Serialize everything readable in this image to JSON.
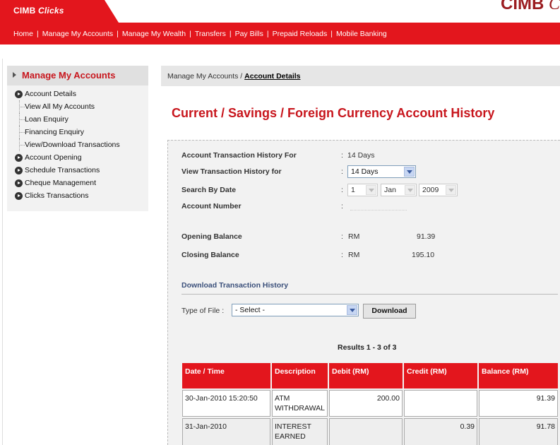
{
  "brand": {
    "name": "CIMB",
    "name_italic": "Clicks",
    "logo_right": "CIMB",
    "logo_right_tail": "C"
  },
  "colors": {
    "accent": "#e3161d",
    "title_red": "#c8161d",
    "link_blue": "#3a4f7a"
  },
  "nav": {
    "items": [
      "Home",
      "Manage My Accounts",
      "Manage My Wealth",
      "Transfers",
      "Pay Bills",
      "Prepaid Reloads",
      "Mobile Banking"
    ]
  },
  "sidebar": {
    "title": "Manage My Accounts",
    "items": [
      {
        "label": "Account Details",
        "type": "main"
      },
      {
        "label": "View All My Accounts",
        "type": "sub"
      },
      {
        "label": "Loan Enquiry",
        "type": "sub"
      },
      {
        "label": "Financing Enquiry",
        "type": "sub"
      },
      {
        "label": "View/Download Transactions",
        "type": "sub"
      },
      {
        "label": "Account Opening",
        "type": "main"
      },
      {
        "label": "Schedule Transactions",
        "type": "main"
      },
      {
        "label": "Cheque Management",
        "type": "main"
      },
      {
        "label": "Clicks Transactions",
        "type": "main"
      }
    ]
  },
  "breadcrumb": {
    "parent": "Manage My Accounts /",
    "current": "Account Details"
  },
  "page_title": "Current / Savings / Foreign Currency Account History",
  "form": {
    "history_for_label": "Account Transaction History For",
    "history_for_value": "14 Days",
    "view_label": "View Transaction History for",
    "view_select": "14 Days",
    "search_label": "Search By Date",
    "day": "1",
    "month": "Jan",
    "year": "2009",
    "account_label": "Account Number",
    "opening_label": "Opening Balance",
    "opening_currency": "RM",
    "opening_value": "91.39",
    "closing_label": "Closing Balance",
    "closing_currency": "RM",
    "closing_value": "195.10",
    "colon": ":"
  },
  "download": {
    "title": "Download Transaction History",
    "file_label": "Type of File :",
    "file_select": "- Select -",
    "button": "Download"
  },
  "results_text": "Results 1 - 3 of 3",
  "table": {
    "headers": [
      "Date / Time",
      "Description",
      "Debit (RM)",
      "Credit (RM)",
      "Balance (RM)"
    ],
    "rows": [
      {
        "date": "30-Jan-2010 15:20:50",
        "desc": "ATM WITHDRAWAL",
        "debit": "200.00",
        "credit": "",
        "balance": "91.39"
      },
      {
        "date": "31-Jan-2010",
        "desc": "INTEREST EARNED",
        "debit": "",
        "credit": "0.39",
        "balance": "91.78"
      }
    ]
  }
}
